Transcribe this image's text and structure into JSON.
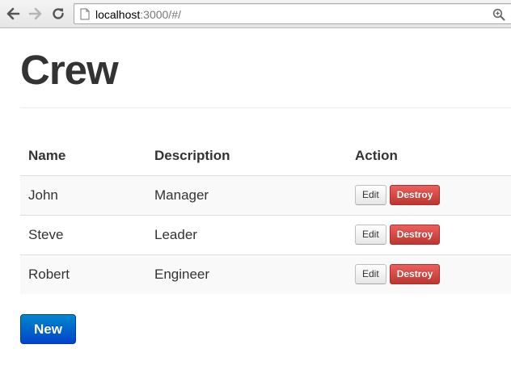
{
  "browser": {
    "url_host": "localhost",
    "url_rest": ":3000/#/"
  },
  "page": {
    "title": "Crew"
  },
  "table": {
    "headers": [
      "Name",
      "Description",
      "Action"
    ],
    "rows": [
      {
        "name": "John",
        "description": "Manager"
      },
      {
        "name": "Steve",
        "description": "Leader"
      },
      {
        "name": "Robert",
        "description": "Engineer"
      }
    ],
    "edit_label": "Edit",
    "destroy_label": "Destroy"
  },
  "actions": {
    "new_label": "New"
  },
  "colors": {
    "destroy": "#da4f49",
    "primary": "#0055cc"
  },
  "icons": [
    "back-arrow-icon",
    "forward-arrow-icon",
    "reload-icon",
    "page-icon",
    "zoom-icon"
  ]
}
